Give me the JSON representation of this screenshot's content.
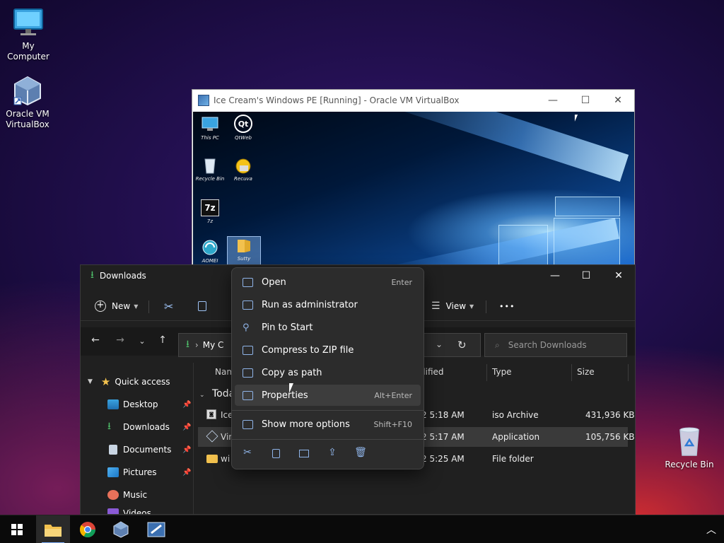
{
  "desktop": {
    "icons": [
      {
        "label": "My Computer"
      },
      {
        "label": "Oracle VM VirtualBox"
      },
      {
        "label": "Recycle Bin"
      }
    ]
  },
  "vbox": {
    "title": "Ice Cream's Windows PE [Running] - Oracle VM VirtualBox",
    "controls": {
      "minimize": "—",
      "maximize": "☐",
      "close": "✕"
    },
    "guest_icons": [
      {
        "label": "This PC"
      },
      {
        "label": "QtWeb"
      },
      {
        "label": "Recycle Bin"
      },
      {
        "label": "Recuva"
      },
      {
        "label": "7z"
      },
      {
        "label": "AOMEI"
      },
      {
        "label": "Sutty"
      }
    ],
    "guest_logo_text": {
      "qtweb": "Qt",
      "sevenzip": "7z"
    }
  },
  "explorer": {
    "title": "Downloads",
    "controls": {
      "minimize": "—",
      "maximize": "☐",
      "close": "✕"
    },
    "toolbar": {
      "new_label": "New",
      "view_label": "View",
      "more": "•••"
    },
    "address": {
      "text": "My C"
    },
    "search": {
      "placeholder": "Search Downloads"
    },
    "sidebar": {
      "quick_access": "Quick access",
      "items": [
        {
          "label": "Desktop"
        },
        {
          "label": "Downloads"
        },
        {
          "label": "Documents"
        },
        {
          "label": "Pictures"
        },
        {
          "label": "Music"
        },
        {
          "label": "Videos"
        }
      ]
    },
    "columns": {
      "name": "Nam",
      "modified": "dified",
      "type": "Type",
      "size": "Size"
    },
    "group_label": "Toda",
    "rows": [
      {
        "name": "Ice",
        "modified": "2 5:18 AM",
        "type": "iso Archive",
        "size": "431,936 KB"
      },
      {
        "name": "Vir",
        "modified": "2 5:17 AM",
        "type": "Application",
        "size": "105,756 KB"
      },
      {
        "name": "wi",
        "modified": "2 5:25 AM",
        "type": "File folder",
        "size": ""
      }
    ]
  },
  "context_menu": {
    "items": [
      {
        "label": "Open",
        "shortcut": "Enter"
      },
      {
        "label": "Run as administrator",
        "shortcut": ""
      },
      {
        "label": "Pin to Start",
        "shortcut": ""
      },
      {
        "label": "Compress to ZIP file",
        "shortcut": ""
      },
      {
        "label": "Copy as path",
        "shortcut": ""
      },
      {
        "label": "Properties",
        "shortcut": "Alt+Enter"
      }
    ],
    "more": {
      "label": "Show more options",
      "shortcut": "Shift+F10"
    }
  },
  "taskbar": {
    "chevron": "︿"
  },
  "colors": {
    "accent": "#7fb1ff",
    "folder": "#f2c14e",
    "download_green": "#4fc06a"
  }
}
